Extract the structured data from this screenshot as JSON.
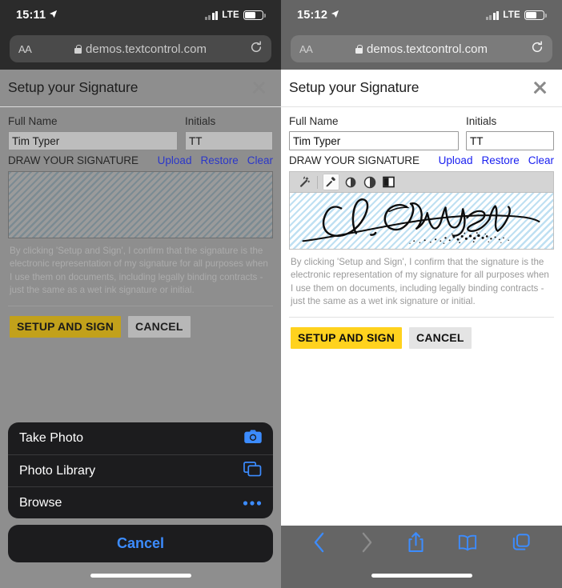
{
  "panels": {
    "left": {
      "status": {
        "time": "15:11",
        "carrier": "LTE"
      },
      "browser": {
        "aa_label": "AA",
        "url": "demos.textcontrol.com"
      },
      "dialog": {
        "title": "Setup your Signature",
        "full_name_label": "Full Name",
        "full_name_value": "Tim Typer",
        "initials_label": "Initials",
        "initials_value": "TT",
        "draw_label": "DRAW YOUR SIGNATURE",
        "links": [
          "Upload",
          "Restore",
          "Clear"
        ],
        "disclaimer": "By clicking 'Setup and Sign', I confirm that the signature is the electronic representation of my signature for all purposes when I use them on documents, including legally binding contracts - just the same as a wet ink signature or initial.",
        "primary_button": "SETUP AND SIGN",
        "secondary_button": "CANCEL"
      },
      "action_sheet": {
        "items": [
          {
            "label": "Take Photo",
            "icon": "camera-icon"
          },
          {
            "label": "Photo Library",
            "icon": "photos-icon"
          },
          {
            "label": "Browse",
            "icon": "ellipsis-icon"
          }
        ],
        "cancel_label": "Cancel"
      }
    },
    "right": {
      "status": {
        "time": "15:12",
        "carrier": "LTE"
      },
      "browser": {
        "aa_label": "AA",
        "url": "demos.textcontrol.com"
      },
      "dialog": {
        "title": "Setup your Signature",
        "full_name_label": "Full Name",
        "full_name_value": "Tim Typer",
        "initials_label": "Initials",
        "initials_value": "TT",
        "draw_label": "DRAW YOUR SIGNATURE",
        "links": [
          "Upload",
          "Restore",
          "Clear"
        ],
        "toolbar_icons": [
          "magic-wand-icon",
          "eyedropper-icon",
          "contrast-filled-icon",
          "contrast-half-icon",
          "threshold-square-icon"
        ],
        "signature_text": "D. Johnson",
        "disclaimer": "By clicking 'Setup and Sign', I confirm that the signature is the electronic representation of my signature for all purposes when I use them on documents, including legally binding contracts - just the same as a wet ink signature or initial.",
        "primary_button": "SETUP AND SIGN",
        "secondary_button": "CANCEL"
      },
      "safari_toolbar": {
        "icons": [
          "back-icon",
          "forward-icon",
          "share-icon",
          "bookmarks-icon",
          "tabs-icon"
        ]
      }
    }
  },
  "colors": {
    "accent_yellow": "#ffd21e",
    "link_blue": "#1a20f0",
    "ios_blue": "#3c8cff",
    "sheet_bg": "#1c1c1e",
    "status_dark": "#2b2b2b",
    "status_gray": "#656565"
  }
}
